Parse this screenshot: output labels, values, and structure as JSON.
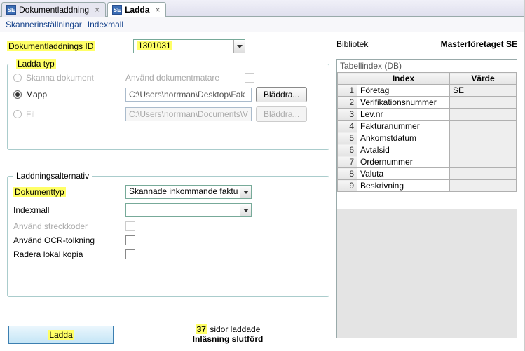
{
  "tabs": [
    {
      "icon": "SE",
      "label": "Dokumentladdning"
    },
    {
      "icon": "SE",
      "label": "Ladda"
    }
  ],
  "menu": {
    "item1": "Skannerinställningar",
    "item2": "Indexmall"
  },
  "doc_id": {
    "label": "Dokumentladdnings ID",
    "value": "1301031"
  },
  "library": {
    "label": "Bibliotek",
    "value": "Masterföretaget SE"
  },
  "ladda_typ": {
    "legend": "Ladda typ",
    "opt_scan": "Skanna dokument",
    "opt_folder": "Mapp",
    "opt_file": "Fil",
    "use_feeder": "Använd dokumentmatare",
    "folder_path": "C:\\Users\\norrman\\Desktop\\Fak",
    "file_path": "C:\\Users\\norrman\\Documents\\V",
    "browse": "Bläddra..."
  },
  "alt": {
    "legend": "Laddningsalternativ",
    "doc_type_label": "Dokumenttyp",
    "doc_type_value": "Skannade inkommande faktu",
    "indexmall_label": "Indexmall",
    "indexmall_value": "",
    "barcode": "Använd streckkoder",
    "ocr": "Använd OCR-tolkning",
    "del_local": "Radera lokal kopia"
  },
  "load_button": "Ladda",
  "status": {
    "pages_num": "37",
    "pages_suffix": " sidor laddade",
    "done": "Inläsning slutförd"
  },
  "table": {
    "title": "Tabellindex (DB)",
    "col_index": "Index",
    "col_value": "Värde",
    "rows": [
      {
        "n": "1",
        "k": "Företag",
        "v": "SE"
      },
      {
        "n": "2",
        "k": "Verifikationsnummer",
        "v": ""
      },
      {
        "n": "3",
        "k": "Lev.nr",
        "v": ""
      },
      {
        "n": "4",
        "k": "Fakturanummer",
        "v": ""
      },
      {
        "n": "5",
        "k": "Ankomstdatum",
        "v": ""
      },
      {
        "n": "6",
        "k": "Avtalsid",
        "v": ""
      },
      {
        "n": "7",
        "k": "Ordernummer",
        "v": ""
      },
      {
        "n": "8",
        "k": "Valuta",
        "v": ""
      },
      {
        "n": "9",
        "k": "Beskrivning",
        "v": ""
      }
    ]
  }
}
